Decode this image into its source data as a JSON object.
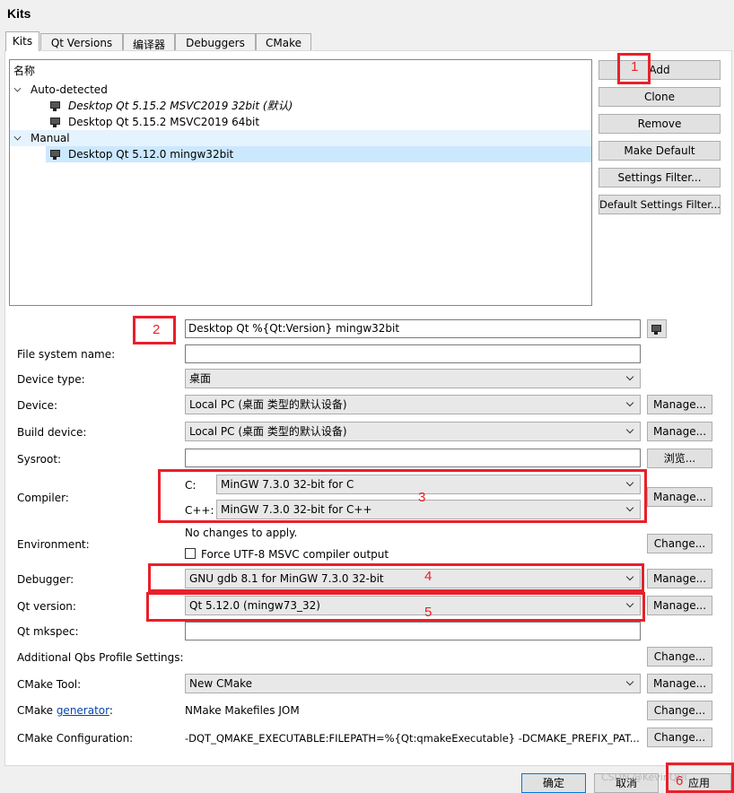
{
  "window": {
    "title": "Kits"
  },
  "tabs": [
    {
      "label": "Kits"
    },
    {
      "label": "Qt Versions"
    },
    {
      "label": "编译器"
    },
    {
      "label": "Debuggers"
    },
    {
      "label": "CMake"
    }
  ],
  "tree": {
    "header": "名称",
    "groups": [
      {
        "label": "Auto-detected",
        "items": [
          {
            "label": "Desktop Qt 5.15.2 MSVC2019 32bit (默认)"
          },
          {
            "label": "Desktop Qt 5.15.2 MSVC2019 64bit"
          }
        ]
      },
      {
        "label": "Manual",
        "items": [
          {
            "label": "Desktop Qt 5.12.0 mingw32bit"
          }
        ]
      }
    ]
  },
  "side_buttons": {
    "add": "Add",
    "clone": "Clone",
    "remove": "Remove",
    "make_default": "Make Default",
    "settings_filter": "Settings Filter...",
    "default_settings_filter": "Default Settings Filter..."
  },
  "form": {
    "name_value": "Desktop Qt %{Qt:Version} mingw32bit",
    "file_system_name": {
      "label": "File system name:",
      "value": ""
    },
    "device_type": {
      "label": "Device type:",
      "value": "桌面"
    },
    "device": {
      "label": "Device:",
      "value": "Local PC (桌面 类型的默认设备)",
      "button": "Manage..."
    },
    "build_device": {
      "label": "Build device:",
      "value": "Local PC (桌面 类型的默认设备)",
      "button": "Manage..."
    },
    "sysroot": {
      "label": "Sysroot:",
      "value": "",
      "button": "浏览..."
    },
    "compiler": {
      "label": "Compiler:",
      "c_label": "C:",
      "c_value": "MinGW 7.3.0 32-bit for C",
      "cpp_label": "C++:",
      "cpp_value": "MinGW 7.3.0 32-bit for C++",
      "button": "Manage..."
    },
    "environment": {
      "label": "Environment:",
      "value": "No changes to apply.",
      "checkbox_label": "Force UTF-8 MSVC compiler output",
      "button": "Change..."
    },
    "debugger": {
      "label": "Debugger:",
      "value": "GNU gdb 8.1 for MinGW 7.3.0 32-bit",
      "button": "Manage..."
    },
    "qt_version": {
      "label": "Qt version:",
      "value": "Qt 5.12.0 (mingw73_32)",
      "button": "Manage..."
    },
    "qt_mkspec": {
      "label": "Qt mkspec:",
      "value": ""
    },
    "qbs": {
      "label": "Additional Qbs Profile Settings:",
      "button": "Change..."
    },
    "cmake_tool": {
      "label": "CMake Tool:",
      "value": "New CMake",
      "button": "Manage..."
    },
    "cmake_generator": {
      "label_prefix": "CMake ",
      "link": "generator",
      "label_suffix": ":",
      "value": "NMake Makefiles JOM",
      "button": "Change..."
    },
    "cmake_config": {
      "label": "CMake Configuration:",
      "value": "-DQT_QMAKE_EXECUTABLE:FILEPATH=%{Qt:qmakeExecutable} -DCMAKE_PREFIX_PAT...",
      "button": "Change..."
    }
  },
  "annotations": [
    "1",
    "2",
    "3",
    "4",
    "5",
    "6"
  ],
  "dialog_buttons": {
    "ok": "确定",
    "cancel": "取消",
    "apply": "应用"
  },
  "watermark": "CSDN @KevinQUI",
  "colors": {
    "annotation_red": "#e8202a",
    "selection": "#cce8ff",
    "hover": "#e5f3ff"
  }
}
